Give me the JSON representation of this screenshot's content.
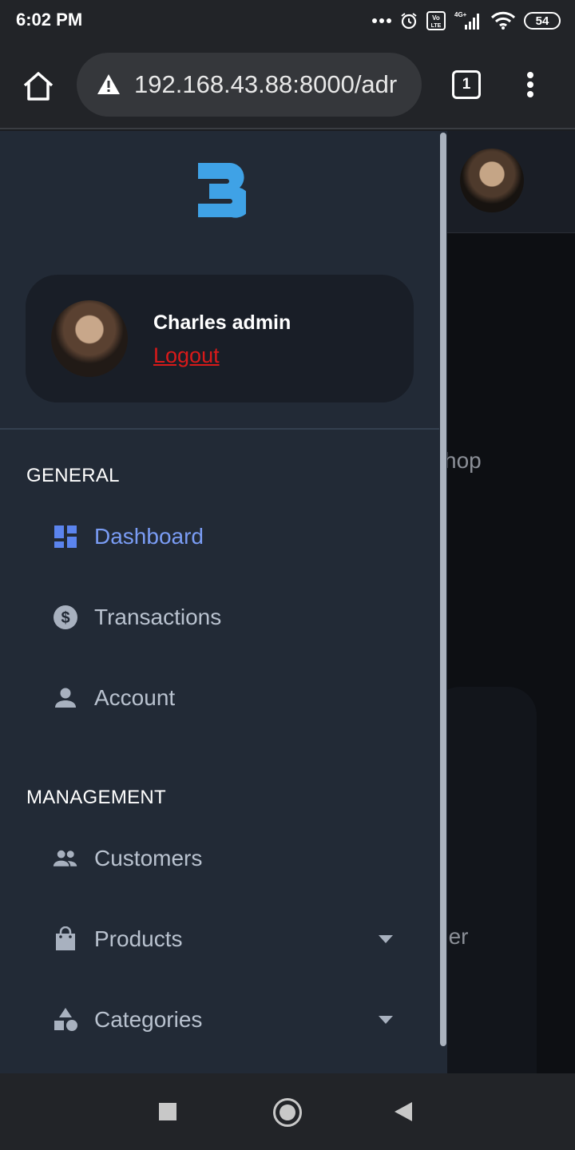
{
  "status_bar": {
    "time": "6:02 PM",
    "battery": "54"
  },
  "browser": {
    "url": "192.168.43.88:8000/adr",
    "tab_count": "1"
  },
  "page_behind": {
    "text_1": "hop",
    "text_2": "der"
  },
  "drawer": {
    "user": {
      "name": "Charles admin",
      "logout": "Logout"
    },
    "sections": [
      {
        "label": "GENERAL"
      },
      {
        "label": "MANAGEMENT"
      }
    ],
    "items": [
      {
        "label": "Dashboard",
        "icon": "dashboard-icon",
        "active": true
      },
      {
        "label": "Transactions",
        "icon": "dollar-icon"
      },
      {
        "label": "Account",
        "icon": "person-icon"
      },
      {
        "label": "Customers",
        "icon": "people-icon"
      },
      {
        "label": "Products",
        "icon": "shopping-bag-icon",
        "expandable": true
      },
      {
        "label": "Categories",
        "icon": "shapes-icon",
        "expandable": true
      }
    ]
  },
  "colors": {
    "accent": "#7a9cf4",
    "logout": "#d91a1a",
    "drawer_bg": "#222a36",
    "logo": "#3fa2e6"
  }
}
